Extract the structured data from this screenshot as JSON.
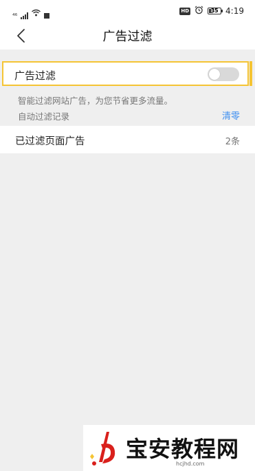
{
  "status_bar": {
    "signal_text": "⁴⁶",
    "battery": "85",
    "time": "4:19",
    "hd_badge": "HD"
  },
  "header": {
    "title": "广告过滤"
  },
  "ad_filter": {
    "toggle_label": "广告过滤",
    "enabled": false,
    "description": "智能过滤网站广告，为您节省更多流量。",
    "record_label": "自动过滤记录",
    "clear_label": "清零"
  },
  "filtered_pages": {
    "label": "已过滤页面广告",
    "count": "2条"
  },
  "watermark": {
    "text": "宝安教程网",
    "url": "hcjhd.com"
  },
  "colors": {
    "accent_yellow": "#f5c433",
    "link_blue": "#3f8ff0",
    "background": "#efefef",
    "switch_off": "#d9d9d9"
  },
  "icons": [
    "signal-icon",
    "wifi-icon",
    "notification-icon",
    "hd-icon",
    "alarm-icon",
    "battery-icon",
    "back-arrow-icon"
  ]
}
